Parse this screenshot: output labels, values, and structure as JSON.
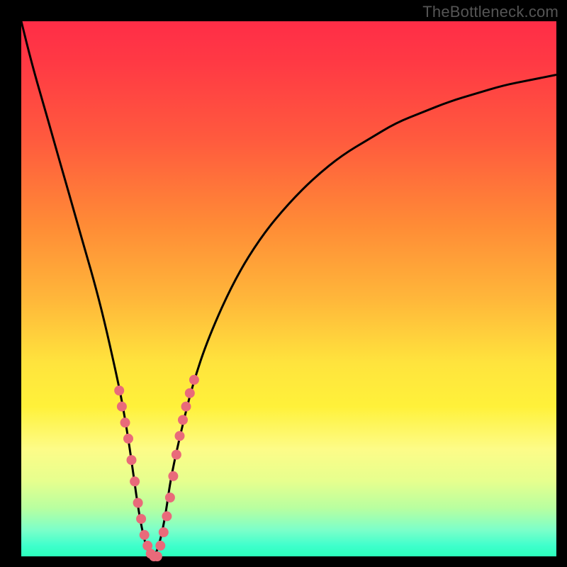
{
  "watermark": "TheBottleneck.com",
  "colors": {
    "gradient_top": "#ff2d47",
    "gradient_mid1": "#ff8b36",
    "gradient_mid2": "#ffe43d",
    "gradient_bottom": "#2bffbb",
    "curve_stroke": "#000000",
    "dot_fill": "#e96a7a",
    "frame_bg": "#000000"
  },
  "chart_data": {
    "type": "line",
    "title": "",
    "xlabel": "",
    "ylabel": "",
    "xlim": [
      0,
      100
    ],
    "ylim": [
      0,
      100
    ],
    "grid": false,
    "x": [
      0,
      2,
      4,
      6,
      8,
      10,
      12,
      14,
      16,
      18,
      19,
      20,
      21,
      22,
      23,
      24,
      25,
      26,
      27,
      28,
      30,
      32,
      35,
      40,
      45,
      50,
      55,
      60,
      65,
      70,
      75,
      80,
      85,
      90,
      95,
      100
    ],
    "values": [
      100,
      92,
      85,
      78,
      71,
      64,
      57,
      50,
      42,
      33,
      28,
      22,
      15,
      8,
      3,
      0,
      0,
      3,
      8,
      15,
      24,
      32,
      41,
      52,
      60,
      66,
      71,
      75,
      78,
      81,
      83,
      85,
      86.5,
      88,
      89,
      90
    ],
    "minimum_x": 24.5,
    "series": [
      {
        "name": "bottleneck-curve",
        "x": [
          0,
          2,
          4,
          6,
          8,
          10,
          12,
          14,
          16,
          18,
          19,
          20,
          21,
          22,
          23,
          24,
          25,
          26,
          27,
          28,
          30,
          32,
          35,
          40,
          45,
          50,
          55,
          60,
          65,
          70,
          75,
          80,
          85,
          90,
          95,
          100
        ],
        "values": [
          100,
          92,
          85,
          78,
          71,
          64,
          57,
          50,
          42,
          33,
          28,
          22,
          15,
          8,
          3,
          0,
          0,
          3,
          8,
          15,
          24,
          32,
          41,
          52,
          60,
          66,
          71,
          75,
          78,
          81,
          83,
          85,
          86.5,
          88,
          89,
          90
        ]
      }
    ],
    "highlight_dots": {
      "x": [
        18.3,
        18.8,
        19.4,
        20.0,
        20.6,
        21.2,
        21.8,
        22.4,
        23.0,
        23.6,
        24.2,
        24.8,
        25.4,
        26.0,
        26.6,
        27.2,
        27.8,
        28.4,
        29.0,
        29.6,
        30.2,
        30.8,
        31.5,
        32.3
      ],
      "values": [
        31,
        28,
        25,
        22,
        18,
        14,
        10,
        7,
        4,
        2,
        0.5,
        0,
        0,
        2,
        4.5,
        7.5,
        11,
        15,
        19,
        22.5,
        25.5,
        28,
        30.5,
        33
      ]
    }
  }
}
